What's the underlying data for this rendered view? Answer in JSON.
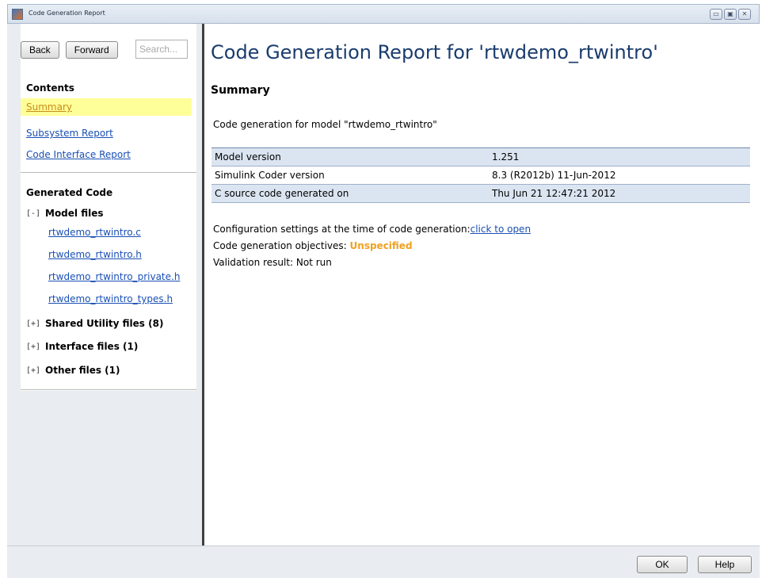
{
  "window": {
    "title": "Code Generation Report",
    "controls": [
      "▭",
      "▣",
      "✕"
    ]
  },
  "nav": {
    "back_label": "Back",
    "forward_label": "Forward",
    "search_placeholder": "Search..."
  },
  "contents": {
    "heading": "Contents",
    "items": [
      {
        "label": "Summary",
        "active": true
      },
      {
        "label": "Subsystem Report",
        "active": false
      },
      {
        "label": "Code Interface Report",
        "active": false
      }
    ]
  },
  "generated_code": {
    "heading": "Generated Code",
    "model_files": {
      "toggle": "[-]",
      "label": "Model files",
      "files": [
        "rtwdemo_rtwintro.c",
        "rtwdemo_rtwintro.h",
        "rtwdemo_rtwintro_private.h",
        "rtwdemo_rtwintro_types.h"
      ]
    },
    "collapsed_groups": [
      {
        "toggle": "[+]",
        "label": "Shared Utility files (8)"
      },
      {
        "toggle": "[+]",
        "label": "Interface files (1)"
      },
      {
        "toggle": "[+]",
        "label": "Other files (1)"
      }
    ]
  },
  "main": {
    "title": "Code Generation Report for 'rtwdemo_rtwintro'",
    "section": "Summary",
    "intro": "Code generation for model \"rtwdemo_rtwintro\"",
    "table": [
      {
        "label": "Model version",
        "value": "1.251"
      },
      {
        "label": "Simulink Coder version",
        "value": "8.3 (R2012b) 11-Jun-2012"
      },
      {
        "label": "C source code generated on",
        "value": "Thu Jun 21 12:47:21 2012"
      }
    ],
    "config_text": "Configuration settings at the time of code generation:",
    "config_link": "click to open",
    "objectives_text": "Code generation objectives: ",
    "objectives_value": "Unspecified",
    "validation": "Validation result: Not run"
  },
  "footer": {
    "ok_label": "OK",
    "help_label": "Help"
  },
  "colors": {
    "link": "#1a4fb4",
    "active_highlight": "#ffff99",
    "table_shade": "#dbe5f1",
    "unspecified": "#f0a020"
  }
}
